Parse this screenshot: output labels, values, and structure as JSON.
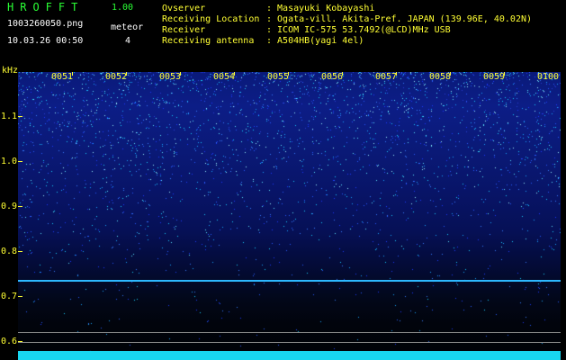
{
  "app": {
    "title": "HROFFT",
    "version": "1.00",
    "file_name": "1003260050.png",
    "datetime": "10.03.26 00:50",
    "meteor_label": "meteor",
    "meteor_count": "4"
  },
  "info": [
    {
      "label": "Ovserver",
      "value": ": Masayuki Kobayashi"
    },
    {
      "label": "Receiving Location",
      "value": ": Ogata-vill. Akita-Pref. JAPAN (139.96E, 40.02N)"
    },
    {
      "label": "Receiver",
      "value": ": ICOM IC-575 53.7492(@LCD)MHz USB"
    },
    {
      "label": "Receiving antenna",
      "value": ": A504HB(yagi 4el)"
    }
  ],
  "spectrogram": {
    "y_unit": "kHz",
    "y_ticks": [
      "1.1",
      "1.0",
      "0.9",
      "0.8",
      "0.7",
      "0.6"
    ],
    "x_ticks": [
      "0051",
      "0052",
      "0053",
      "0054",
      "0055",
      "0056",
      "0057",
      "0058",
      "0059",
      "0100"
    ],
    "colors": {
      "label": "#ffff33",
      "title": "#2aff35",
      "meteor_trace": "#2db8ff",
      "baseline": "#18d6f0"
    }
  }
}
